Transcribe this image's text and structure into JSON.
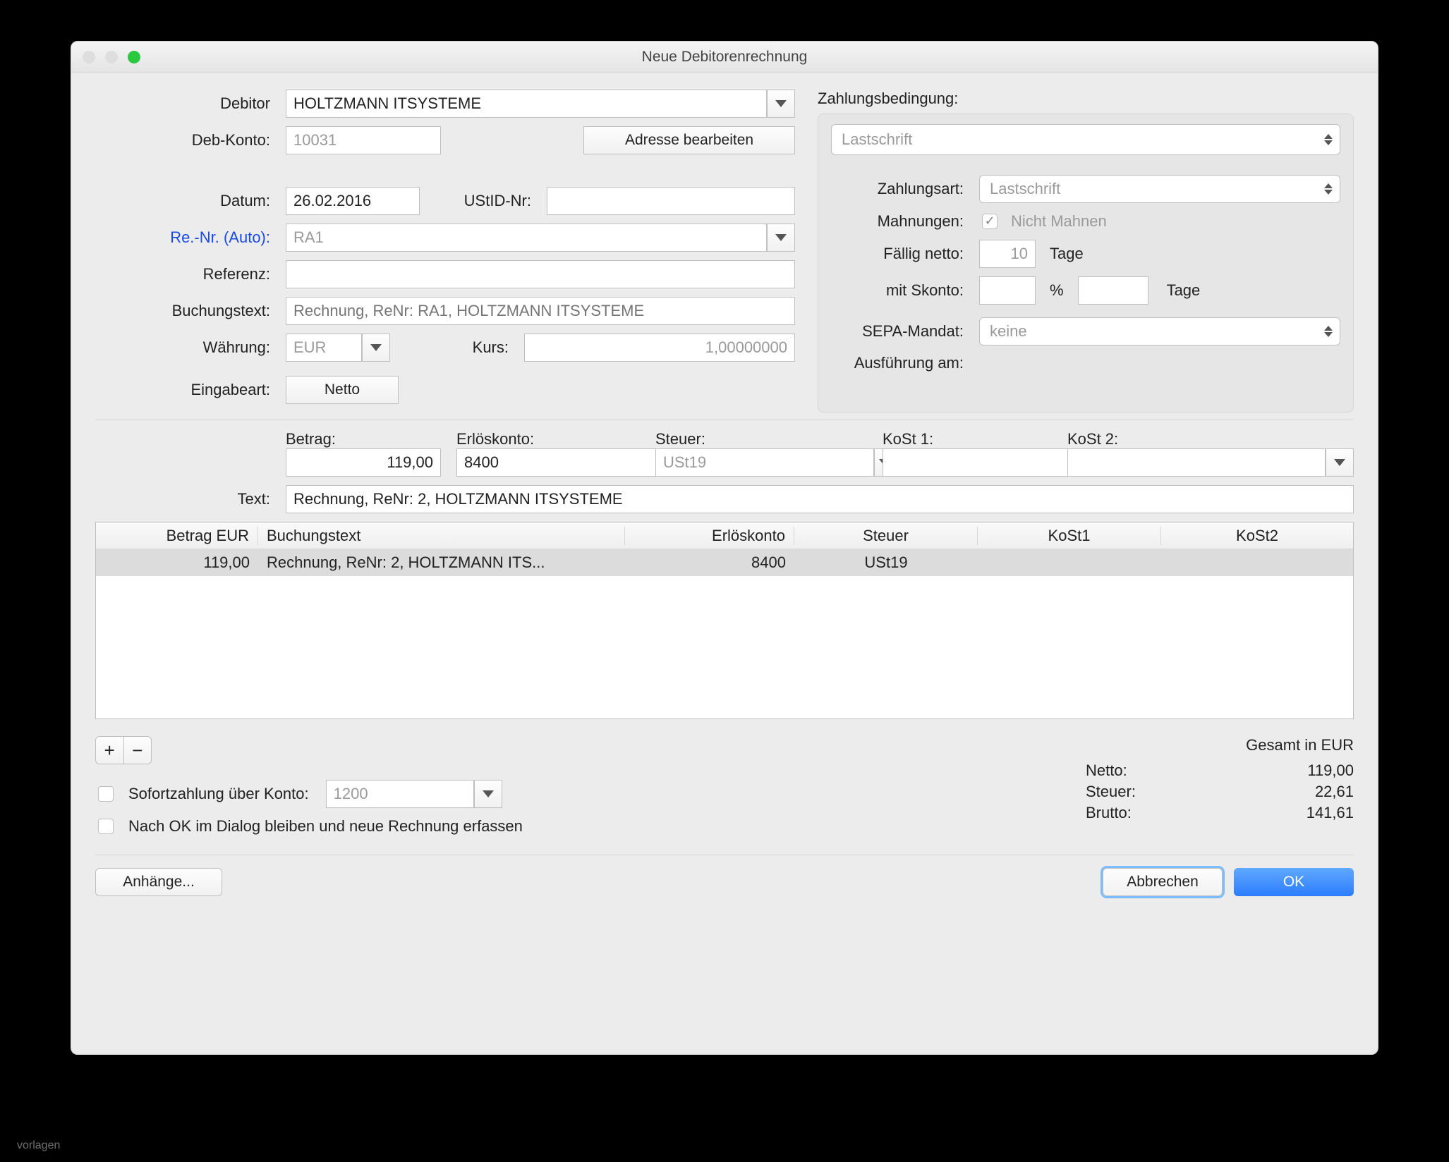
{
  "watermark": "vorlagen",
  "window": {
    "title": "Neue Debitorenrechnung"
  },
  "labels": {
    "debitor": "Debitor",
    "debkonto": "Deb-Konto:",
    "adresse_btn": "Adresse bearbeiten",
    "datum": "Datum:",
    "ustidnr": "UStID-Nr:",
    "renr": "Re.-Nr. (Auto):",
    "referenz": "Referenz:",
    "buchungstext": "Buchungstext:",
    "waehrung": "Währung:",
    "kurs": "Kurs:",
    "eingabeart": "Eingabeart:",
    "netto_btn": "Netto",
    "zahlungsbedingung": "Zahlungsbedingung:",
    "zahlungsart": "Zahlungsart:",
    "mahnungen": "Mahnungen:",
    "nicht_mahnen": "Nicht Mahnen",
    "faellig_netto": "Fällig netto:",
    "tage": "Tage",
    "mit_skonto": "mit Skonto:",
    "percent": "%",
    "sepa_mandat": "SEPA-Mandat:",
    "ausfuehrung": "Ausführung am:",
    "betrag": "Betrag:",
    "erloeskonto": "Erlöskonto:",
    "steuer": "Steuer:",
    "kost1": "KoSt 1:",
    "kost2": "KoSt 2:",
    "text": "Text:",
    "sofortzahlung": "Sofortzahlung über Konto:",
    "nach_ok": "Nach OK im Dialog bleiben und neue Rechnung erfassen",
    "anhaenge": "Anhänge...",
    "abbrechen": "Abbrechen",
    "ok": "OK",
    "gesamt": "Gesamt in EUR",
    "netto_total": "Netto:",
    "steuer_total": "Steuer:",
    "brutto_total": "Brutto:"
  },
  "fields": {
    "debitor": "HOLTZMANN ITSYSTEME",
    "debkonto": "10031",
    "datum": "26.02.2016",
    "ustidnr": "",
    "renr": "RA1",
    "referenz": "",
    "buchungstext_ph": "Rechnung, ReNr: RA1, HOLTZMANN ITSYSTEME",
    "waehrung": "EUR",
    "kurs": "1,00000000",
    "payment_top": "Lastschrift",
    "zahlungsart": "Lastschrift",
    "faellig_netto": "10",
    "skonto_pct": "",
    "skonto_tage": "",
    "sepa": "keine",
    "ausfuehrung": "",
    "betrag": "119,00",
    "erloeskonto": "8400",
    "steuer_sel": "USt19",
    "kost1": "",
    "kost2": "",
    "text": "Rechnung, ReNr: 2, HOLTZMANN ITSYSTEME",
    "sofort_konto": "1200"
  },
  "table": {
    "headers": [
      "Betrag EUR",
      "Buchungstext",
      "Erlöskonto",
      "Steuer",
      "KoSt1",
      "KoSt2"
    ],
    "row": {
      "betrag": "119,00",
      "text": "Rechnung, ReNr: 2, HOLTZMANN ITS...",
      "konto": "8400",
      "steuer": "USt19",
      "kost1": "",
      "kost2": ""
    }
  },
  "totals": {
    "netto": "119,00",
    "steuer": "22,61",
    "brutto": "141,61"
  }
}
